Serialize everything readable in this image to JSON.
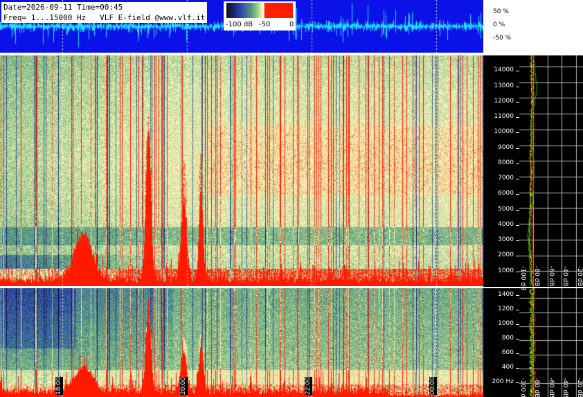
{
  "header": {
    "info_line1": "Date=2026-09-11 Time=00:45",
    "info_line2": "Freq= 1...15000 Hz   VLF E-field @www.vlf.it"
  },
  "colorbar": {
    "labels": [
      "-100 dB",
      "-50",
      "0"
    ]
  },
  "waveform": {
    "scale_labels": [
      "50 %",
      "0 %",
      "-50 %"
    ]
  },
  "colors": {
    "waveform_bg": "#0a12e8",
    "waveform_trace": "#1ee0ff",
    "profile_avg": "#ffff00",
    "profile_max": "#ff2200",
    "profile_min": "#00c000",
    "grid": "#ffffff"
  },
  "chart_data": [
    {
      "type": "heatmap",
      "title": "",
      "ylabel": "",
      "ylim": [
        0,
        15000
      ],
      "yticks": [
        "1000",
        "2000",
        "3000",
        "4000",
        "5000",
        "6000",
        "7000",
        "8000",
        "9000",
        "10000",
        "11000",
        "12000",
        "13000",
        "14000"
      ],
      "time_ticks": [
        "18:00",
        "20:00",
        "22:00",
        "00:00"
      ],
      "color_scale_db": [
        -100,
        0
      ]
    },
    {
      "type": "heatmap",
      "title": "",
      "ylabel": "",
      "ylim": [
        0,
        1500
      ],
      "yticks": [
        "200 Hz",
        "400",
        "600",
        "800",
        "1000",
        "1200",
        "1400"
      ],
      "time_ticks": [
        "18:00",
        "20:00",
        "22:00",
        "00:00"
      ],
      "color_scale_db": [
        -100,
        0
      ]
    },
    {
      "type": "line",
      "title": "",
      "xlabel": "",
      "xticks": [
        "-100 dB",
        "-80 dB",
        "-60 dB",
        "-40 dB",
        "-20 dB"
      ],
      "xlim": [
        -100,
        -10
      ],
      "series": [
        {
          "values_db": [
            -82,
            -83,
            -84,
            -86,
            -85,
            -84,
            -84,
            -83,
            -84,
            -83,
            -83,
            -82,
            -82,
            -83,
            -83
          ]
        },
        {
          "values_db": [
            -80,
            -80,
            -81,
            -82,
            -82,
            -81,
            -81,
            -81,
            -81,
            -80,
            -80,
            -80,
            -80,
            -80,
            -80
          ]
        },
        {
          "values_db": [
            -84,
            -85,
            -86,
            -88,
            -86,
            -82,
            -80,
            -79,
            -80,
            -82,
            -83,
            -79,
            -75,
            -78,
            -80
          ]
        }
      ]
    }
  ]
}
